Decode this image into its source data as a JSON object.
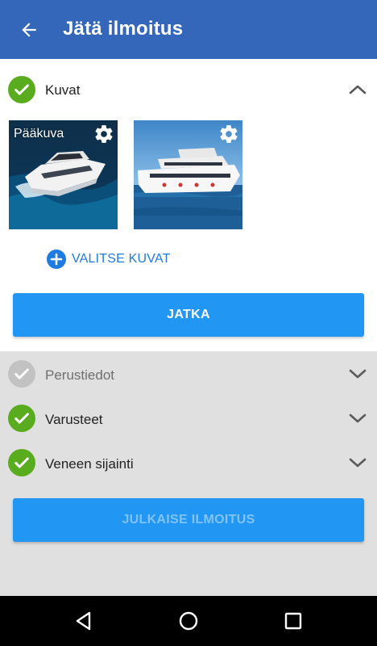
{
  "app_bar": {
    "title": "Jätä ilmoitus",
    "back_icon": "arrow-left-icon",
    "color": "#3467b9"
  },
  "images_section": {
    "label": "Kuvat",
    "status": "completed",
    "expanded": true,
    "thumbnails": [
      {
        "caption": "Pääkuva",
        "description": "white motor yacht cruising at sea",
        "icon": "gear-icon"
      },
      {
        "caption": "",
        "description": "white passenger boat on blue water",
        "icon": "gear-icon"
      }
    ],
    "add_label": "VALITSE KUVAT"
  },
  "continue_button": {
    "label": "JATKA",
    "color": "#2196f3"
  },
  "sections": [
    {
      "label": "Perustiedot",
      "status": "incomplete"
    },
    {
      "label": "Varusteet",
      "status": "completed"
    },
    {
      "label": "Veneen sijainti",
      "status": "completed"
    }
  ],
  "publish_button": {
    "label": "JULKAISE ILMOITUS",
    "enabled": false
  },
  "colors": {
    "check_green": "#5aac1f",
    "check_grey": "#c2c2c2",
    "link_blue": "#1f7be0"
  },
  "nav_bar": {
    "icons": [
      "back-triangle-icon",
      "home-circle-icon",
      "recents-square-icon"
    ]
  }
}
